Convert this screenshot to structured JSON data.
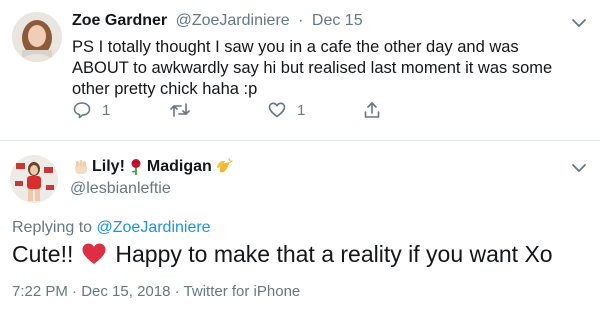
{
  "tweet1": {
    "display_name": "Zoe Gardner",
    "handle": "@ZoeJardiniere",
    "separator": "·",
    "date": "Dec 15",
    "text": "PS I totally thought I saw you in a cafe the other day and was ABOUT to awkwardly say hi but realised last moment it was some other pretty chick haha :p",
    "reply_count": "1",
    "retweet_count": "",
    "like_count": "1",
    "icons": [
      "reply-icon",
      "retweet-icon",
      "like-icon",
      "share-icon",
      "chevron-down-icon"
    ]
  },
  "tweet2": {
    "name_part1": "Lily!",
    "name_part2": "Madigan",
    "name_emojis": [
      "raised-fist-emoji",
      "rose-emoji",
      "clapping-hands-emoji"
    ],
    "handle": "@lesbianleftie",
    "replying_prefix": "Replying to",
    "replying_handle": "@ZoeJardiniere",
    "text_before": "Cute!!",
    "text_after": "Happy to make that a reality if you want Xo",
    "text_emoji": "red-heart-emoji",
    "time": "7:22 PM",
    "date": "Dec 15, 2018",
    "separator": "·",
    "client": "Twitter for iPhone"
  },
  "colors": {
    "link": "#1b95e0",
    "muted": "#657786",
    "text": "#14171a",
    "divider": "#e1e8ed",
    "heart": "#e0245e"
  }
}
